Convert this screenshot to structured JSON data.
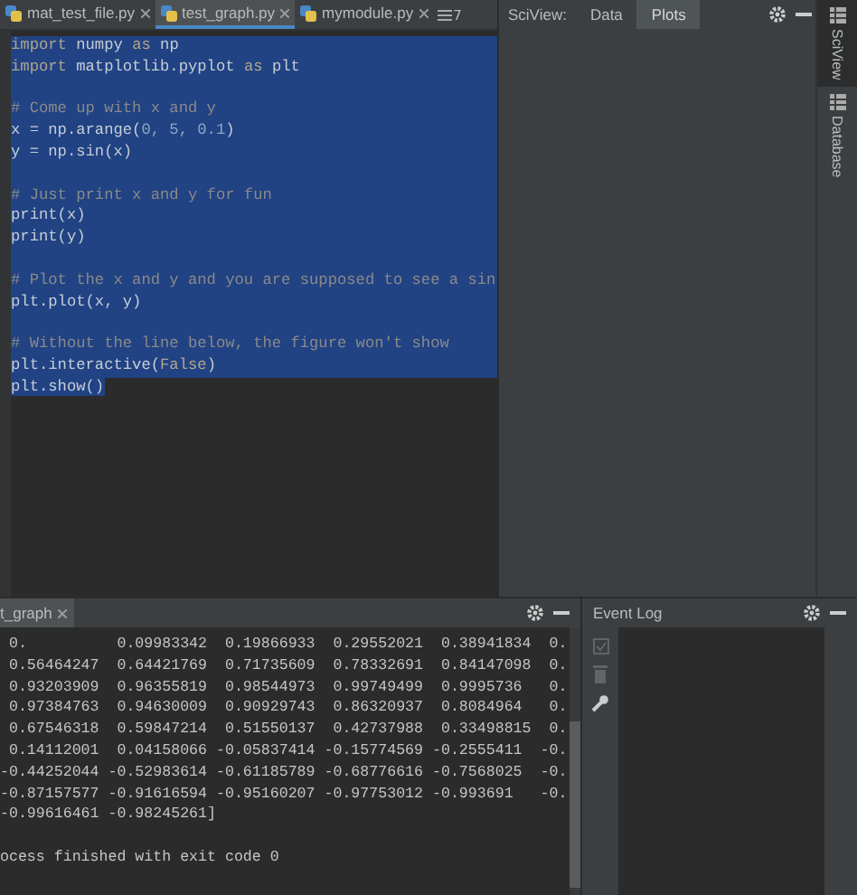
{
  "file_tabs": [
    {
      "label": "mat_test_file.py",
      "selected": false
    },
    {
      "label": "test_graph.py",
      "selected": true
    },
    {
      "label": "mymodule.py",
      "selected": false
    }
  ],
  "overflow_count": "7",
  "code_lines": [
    {
      "selected": true,
      "segments": [
        {
          "kind": "keyword",
          "text": "import"
        },
        {
          "kind": "plain",
          "text": " numpy "
        },
        {
          "kind": "keyword",
          "text": "as"
        },
        {
          "kind": "plain",
          "text": " np"
        }
      ]
    },
    {
      "selected": true,
      "segments": [
        {
          "kind": "keyword",
          "text": "import"
        },
        {
          "kind": "plain",
          "text": " matplotlib.pyplot "
        },
        {
          "kind": "keyword",
          "text": "as"
        },
        {
          "kind": "plain",
          "text": " plt"
        }
      ]
    },
    {
      "selected": true
    },
    {
      "selected": true,
      "segments": [
        {
          "kind": "comment",
          "text": "# Come up with x and y"
        }
      ]
    },
    {
      "selected": true,
      "segments": [
        {
          "kind": "plain",
          "text": "x = np.arange("
        },
        {
          "kind": "number",
          "text": "0, 5, 0.1"
        },
        {
          "kind": "plain",
          "text": ")"
        }
      ]
    },
    {
      "selected": true,
      "segments": [
        {
          "kind": "plain",
          "text": "y = np.sin(x)"
        }
      ]
    },
    {
      "selected": true
    },
    {
      "selected": true,
      "segments": [
        {
          "kind": "comment",
          "text": "# Just print x and y for fun"
        }
      ]
    },
    {
      "selected": true,
      "segments": [
        {
          "kind": "plain",
          "text": "print(x)"
        }
      ]
    },
    {
      "selected": true,
      "segments": [
        {
          "kind": "plain",
          "text": "print(y)"
        }
      ]
    },
    {
      "selected": true
    },
    {
      "selected": true,
      "segments": [
        {
          "kind": "comment",
          "text": "# Plot the x and y and you are supposed to see a sin"
        }
      ]
    },
    {
      "selected": true,
      "segments": [
        {
          "kind": "plain",
          "text": "plt.plot(x, y)"
        }
      ]
    },
    {
      "selected": true
    },
    {
      "selected": true,
      "segments": [
        {
          "kind": "comment",
          "text": "# Without the line below, the figure won't show"
        }
      ]
    },
    {
      "selected": true,
      "segments": [
        {
          "kind": "plain",
          "text": "plt.interactive("
        },
        {
          "kind": "keyword",
          "text": "False"
        },
        {
          "kind": "plain",
          "text": ")"
        }
      ]
    },
    {
      "selected": true,
      "segments": [
        {
          "kind": "plain",
          "text": "plt.show()"
        }
      ]
    }
  ],
  "sciview": {
    "label": "SciView:",
    "tabs": [
      {
        "label": "Data",
        "selected": false
      },
      {
        "label": "Plots",
        "selected": true
      }
    ]
  },
  "side_tabs": [
    {
      "label": "SciView",
      "selected": true
    },
    {
      "label": "Database",
      "selected": false
    }
  ],
  "run_panel": {
    "tab": "t_graph",
    "output": [
      " 0.          0.09983342  0.19866933  0.29552021  0.38941834  0.",
      " 0.56464247  0.64421769  0.71735609  0.78332691  0.84147098  0.",
      " 0.93203909  0.96355819  0.98544973  0.99749499  0.9995736   0.",
      " 0.97384763  0.94630009  0.90929743  0.86320937  0.8084964   0.",
      " 0.67546318  0.59847214  0.51550137  0.42737988  0.33498815  0.",
      " 0.14112001  0.04158066 -0.05837414 -0.15774569 -0.2555411  -0.",
      "-0.44252044 -0.52983614 -0.61185789 -0.68776616 -0.7568025  -0.",
      "-0.87157577 -0.91616594 -0.95160207 -0.97753012 -0.993691   -0.",
      "-0.99616461 -0.98245261]"
    ],
    "exit_message": "ocess finished with exit code 0"
  },
  "event_log": {
    "title": "Event Log",
    "tools": [
      {
        "kind": "check",
        "disabled": true
      },
      {
        "kind": "trash",
        "disabled": true
      },
      {
        "kind": "wrench",
        "disabled": false
      }
    ]
  }
}
